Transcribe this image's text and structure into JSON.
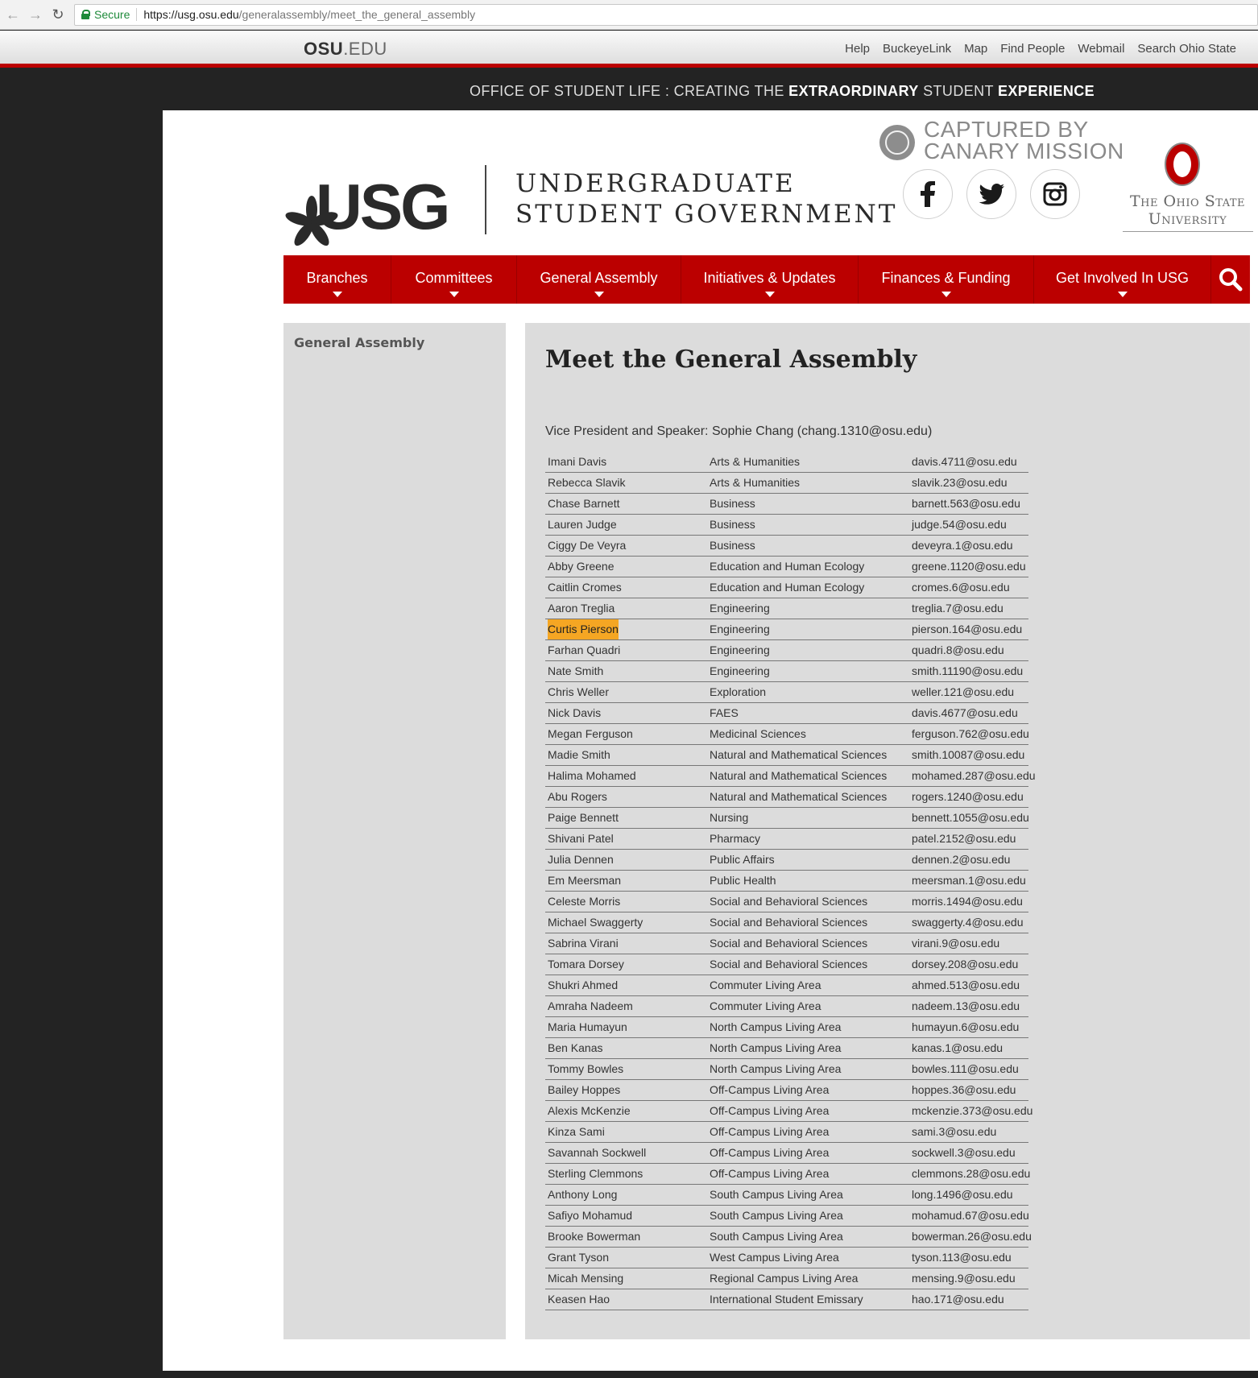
{
  "browser": {
    "secure_label": "Secure",
    "url_host": "https://usg.osu.edu",
    "url_path": "/generalassembly/meet_the_general_assembly"
  },
  "osu_bar": {
    "logo_main": "OSU",
    "logo_suffix": ".EDU",
    "links": [
      "Help",
      "BuckeyeLink",
      "Map",
      "Find People",
      "Webmail",
      "Search Ohio State"
    ]
  },
  "student_life": {
    "part1": "OFFICE OF STUDENT LIFE : CREATING THE ",
    "bold1": "EXTRAORDINARY",
    "part2": " STUDENT ",
    "bold2": "EXPERIENCE"
  },
  "header": {
    "logo_text": "USG",
    "title_line1": "UNDERGRADUATE",
    "title_line2": "STUDENT GOVERNMENT",
    "canary_line1": "CAPTURED BY",
    "canary_line2": "CANARY MISSION",
    "osu_name_line1": "The Ohio State",
    "osu_name_line2": "University"
  },
  "nav": {
    "items": [
      {
        "label": "Branches"
      },
      {
        "label": "Committees"
      },
      {
        "label": "General Assembly"
      },
      {
        "label": "Initiatives & Updates"
      },
      {
        "label": "Finances & Funding"
      },
      {
        "label": "Get Involved In USG"
      }
    ]
  },
  "sidebar": {
    "title": "General Assembly"
  },
  "main": {
    "title": "Meet the General Assembly",
    "speaker": "Vice President and Speaker: Sophie Chang (chang.1310@osu.edu)",
    "highlight_color": "#f5a623",
    "members": [
      {
        "name": "Imani Davis",
        "college": "Arts & Humanities",
        "email": "davis.4711@osu.edu"
      },
      {
        "name": "Rebecca Slavik",
        "college": "Arts & Humanities",
        "email": "slavik.23@osu.edu"
      },
      {
        "name": "Chase Barnett",
        "college": "Business",
        "email": "barnett.563@osu.edu"
      },
      {
        "name": "Lauren Judge",
        "college": "Business",
        "email": "judge.54@osu.edu"
      },
      {
        "name": "Ciggy De Veyra",
        "college": "Business",
        "email": "deveyra.1@osu.edu"
      },
      {
        "name": "Abby Greene",
        "college": "Education and Human Ecology",
        "email": "greene.1120@osu.edu"
      },
      {
        "name": "Caitlin Cromes",
        "college": "Education and Human Ecology",
        "email": "cromes.6@osu.edu"
      },
      {
        "name": "Aaron Treglia",
        "college": "Engineering",
        "email": "treglia.7@osu.edu"
      },
      {
        "name": "Curtis Pierson",
        "college": "Engineering",
        "email": "pierson.164@osu.edu",
        "highlight": true
      },
      {
        "name": "Farhan Quadri",
        "college": "Engineering",
        "email": "quadri.8@osu.edu"
      },
      {
        "name": "Nate Smith",
        "college": "Engineering",
        "email": "smith.11190@osu.edu"
      },
      {
        "name": "Chris Weller",
        "college": "Exploration",
        "email": "weller.121@osu.edu"
      },
      {
        "name": "Nick Davis",
        "college": "FAES",
        "email": "davis.4677@osu.edu"
      },
      {
        "name": "Megan Ferguson",
        "college": "Medicinal Sciences",
        "email": "ferguson.762@osu.edu"
      },
      {
        "name": "Madie Smith",
        "college": "Natural and Mathematical Sciences",
        "email": "smith.10087@osu.edu"
      },
      {
        "name": "Halima Mohamed",
        "college": "Natural and Mathematical Sciences",
        "email": "mohamed.287@osu.edu"
      },
      {
        "name": "Abu Rogers",
        "college": "Natural and Mathematical Sciences",
        "email": "rogers.1240@osu.edu"
      },
      {
        "name": "Paige Bennett",
        "college": "Nursing",
        "email": "bennett.1055@osu.edu"
      },
      {
        "name": "Shivani Patel",
        "college": "Pharmacy",
        "email": "patel.2152@osu.edu"
      },
      {
        "name": "Julia Dennen",
        "college": "Public Affairs",
        "email": "dennen.2@osu.edu"
      },
      {
        "name": "Em Meersman",
        "college": "Public Health",
        "email": "meersman.1@osu.edu"
      },
      {
        "name": "Celeste Morris",
        "college": "Social and Behavioral Sciences",
        "email": "morris.1494@osu.edu"
      },
      {
        "name": "Michael Swaggerty",
        "college": "Social and Behavioral Sciences",
        "email": "swaggerty.4@osu.edu"
      },
      {
        "name": "Sabrina Virani",
        "college": "Social and Behavioral Sciences",
        "email": "virani.9@osu.edu"
      },
      {
        "name": "Tomara Dorsey",
        "college": "Social and Behavioral Sciences",
        "email": "dorsey.208@osu.edu"
      },
      {
        "name": "Shukri Ahmed",
        "college": "Commuter Living Area",
        "email": "ahmed.513@osu.edu"
      },
      {
        "name": "Amraha Nadeem",
        "college": "Commuter Living Area",
        "email": "nadeem.13@osu.edu"
      },
      {
        "name": "Maria Humayun",
        "college": "North Campus Living Area",
        "email": "humayun.6@osu.edu"
      },
      {
        "name": "Ben Kanas",
        "college": "North Campus Living Area",
        "email": "kanas.1@osu.edu"
      },
      {
        "name": "Tommy Bowles",
        "college": "North Campus Living Area",
        "email": "bowles.111@osu.edu"
      },
      {
        "name": "Bailey Hoppes",
        "college": "Off-Campus Living Area",
        "email": "hoppes.36@osu.edu"
      },
      {
        "name": "Alexis McKenzie",
        "college": "Off-Campus Living Area",
        "email": "mckenzie.373@osu.edu"
      },
      {
        "name": "Kinza Sami",
        "college": "Off-Campus Living Area",
        "email": "sami.3@osu.edu"
      },
      {
        "name": "Savannah Sockwell",
        "college": "Off-Campus Living Area",
        "email": "sockwell.3@osu.edu"
      },
      {
        "name": "Sterling Clemmons",
        "college": "Off-Campus Living Area",
        "email": "clemmons.28@osu.edu"
      },
      {
        "name": "Anthony Long",
        "college": "South Campus Living Area",
        "email": "long.1496@osu.edu"
      },
      {
        "name": "Safiyo Mohamud",
        "college": "South Campus Living Area",
        "email": "mohamud.67@osu.edu"
      },
      {
        "name": "Brooke Bowerman",
        "college": "South Campus Living Area",
        "email": "bowerman.26@osu.edu"
      },
      {
        "name": "Grant Tyson",
        "college": "West Campus Living Area",
        "email": "tyson.113@osu.edu"
      },
      {
        "name": "Micah Mensing",
        "college": "Regional Campus Living Area",
        "email": "mensing.9@osu.edu"
      },
      {
        "name": "Keasen Hao",
        "college": "International Student Emissary",
        "email": "hao.171@osu.edu"
      }
    ]
  }
}
